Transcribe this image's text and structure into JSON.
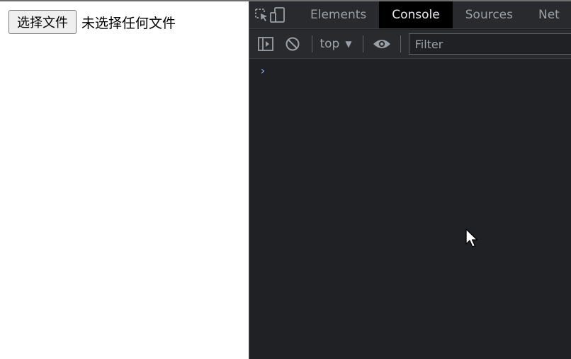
{
  "page": {
    "file_button_label": "选择文件",
    "file_status": "未选择任何文件"
  },
  "devtools": {
    "tabs": [
      {
        "label": "Elements",
        "active": false
      },
      {
        "label": "Console",
        "active": true
      },
      {
        "label": "Sources",
        "active": false
      },
      {
        "label": "Net",
        "active": false
      }
    ],
    "toolbar": {
      "context_label": "top",
      "filter_placeholder": "Filter"
    },
    "console": {
      "prompt_symbol": "›"
    },
    "icons": {
      "inspect": "inspect-element-icon",
      "device": "device-toolbar-icon",
      "sidebar": "show-sidebar-icon",
      "clear": "clear-console-icon",
      "eye": "live-expression-icon"
    },
    "colors": {
      "panel_bg": "#202124",
      "toolbar_bg": "#292a2d",
      "active_tab_bg": "#000000",
      "text_dim": "#9aa0a6",
      "text_bright": "#e8eaed",
      "prompt": "#8ab4f8"
    }
  }
}
